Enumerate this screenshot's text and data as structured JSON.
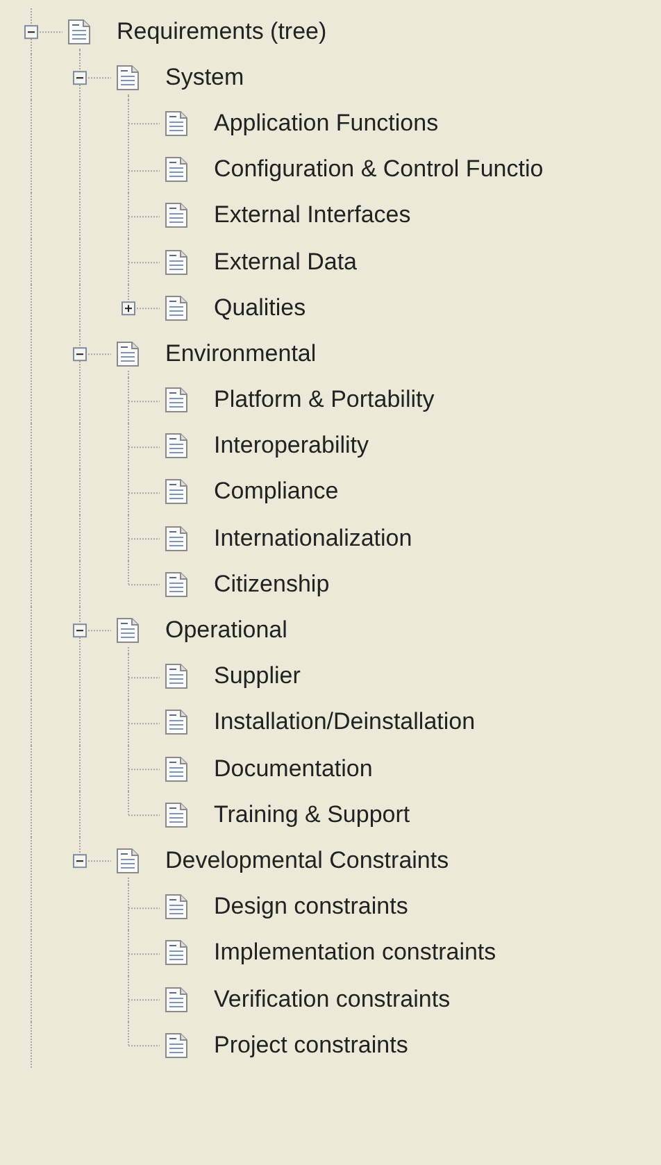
{
  "tree": [
    {
      "label": "Requirements (tree)",
      "expanded": true,
      "children": [
        {
          "label": "System",
          "expanded": true,
          "children": [
            {
              "label": "Application Functions"
            },
            {
              "label": "Configuration & Control Functio"
            },
            {
              "label": "External Interfaces"
            },
            {
              "label": "External Data"
            },
            {
              "label": "Qualities",
              "expanded": false
            }
          ]
        },
        {
          "label": "Environmental",
          "expanded": true,
          "children": [
            {
              "label": "Platform & Portability"
            },
            {
              "label": "Interoperability"
            },
            {
              "label": "Compliance"
            },
            {
              "label": "Internationalization"
            },
            {
              "label": "Citizenship"
            }
          ]
        },
        {
          "label": "Operational",
          "expanded": true,
          "children": [
            {
              "label": "Supplier"
            },
            {
              "label": "Installation/Deinstallation"
            },
            {
              "label": "Documentation"
            },
            {
              "label": "Training & Support"
            }
          ]
        },
        {
          "label": "Developmental Constraints",
          "expanded": true,
          "children": [
            {
              "label": "Design constraints"
            },
            {
              "label": "Implementation constraints"
            },
            {
              "label": "Verification constraints"
            },
            {
              "label": "Project constraints"
            }
          ]
        }
      ]
    }
  ]
}
